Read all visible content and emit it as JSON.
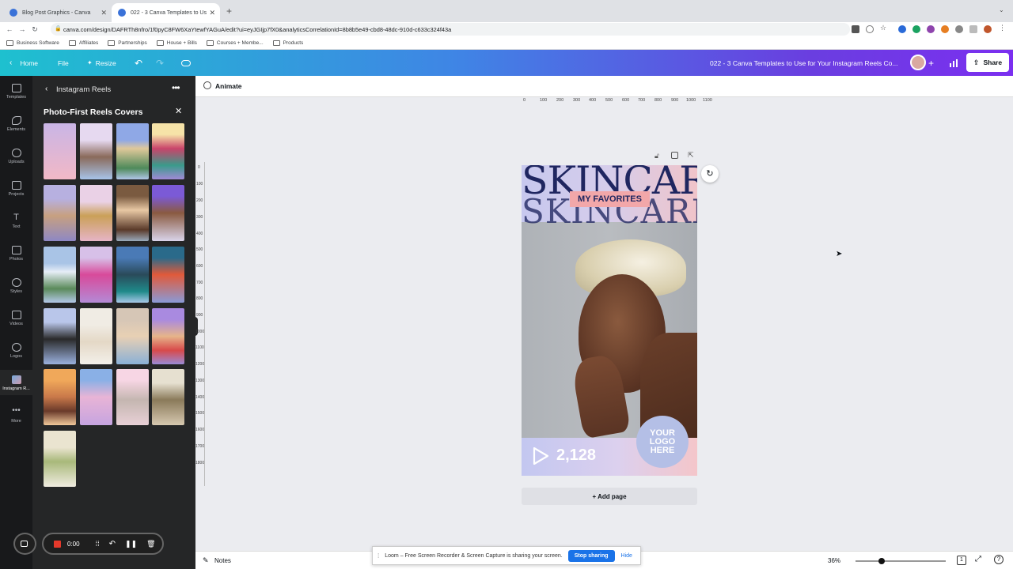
{
  "browser": {
    "tabs": [
      {
        "title": "Blog Post Graphics - Canva"
      },
      {
        "title": "022 - 3 Canva Templates to Us"
      }
    ],
    "url": "canva.com/design/DAFRTh8nfro/1f0pyC8FW6XaYtewfYAGuA/edit?ui=eyJGIjp7fX0&analyticsCorrelationId=8b8b5e49-cbd8-48dc-910d-c633c324f43a",
    "bookmarks": [
      "Business Software",
      "Affiliates",
      "Partnerships",
      "House + Bills",
      "Courses + Membe...",
      "Products"
    ]
  },
  "header": {
    "home": "Home",
    "file": "File",
    "resize": "Resize",
    "doc_title": "022 - 3 Canva Templates to Use for Your Instagram Reels Co...",
    "share": "Share"
  },
  "rail": [
    {
      "label": "Templates",
      "icon": "templates-icon"
    },
    {
      "label": "Elements",
      "icon": "elements-icon"
    },
    {
      "label": "Uploads",
      "icon": "uploads-icon"
    },
    {
      "label": "Projects",
      "icon": "projects-icon"
    },
    {
      "label": "Text",
      "icon": "text-icon"
    },
    {
      "label": "Photos",
      "icon": "photos-icon"
    },
    {
      "label": "Styles",
      "icon": "styles-icon"
    },
    {
      "label": "Videos",
      "icon": "videos-icon"
    },
    {
      "label": "Logos",
      "icon": "logos-icon"
    },
    {
      "label": "Instagram R...",
      "icon": "instagram-reels-icon"
    },
    {
      "label": "More",
      "icon": "more-icon"
    }
  ],
  "panel": {
    "back_title": "Instagram Reels",
    "section_title": "Photo-First Reels Covers"
  },
  "toolbar": {
    "animate": "Animate"
  },
  "ruler_top": [
    "0",
    "100",
    "200",
    "300",
    "400",
    "500",
    "600",
    "700",
    "800",
    "900",
    "1000",
    "1100"
  ],
  "ruler_left": [
    "0",
    "100",
    "200",
    "300",
    "400",
    "500",
    "600",
    "700",
    "800",
    "900",
    "1000",
    "1100",
    "1200",
    "1300",
    "1400",
    "1500",
    "1600",
    "1700",
    "1800"
  ],
  "design": {
    "headline": "SKINCARE",
    "headline_echo": "SKINCARE",
    "ribbon": "MY FAVORITES",
    "views": "2,128",
    "logo_text": "YOUR LOGO HERE"
  },
  "add_page": "+ Add page",
  "footer": {
    "notes": "Notes",
    "zoom": "36%",
    "page_count": "1",
    "zoom_level": 0.36
  },
  "recorder": {
    "time": "0:00"
  },
  "loom": {
    "message": "Loom – Free Screen Recorder & Screen Capture is sharing your screen.",
    "stop": "Stop sharing",
    "hide": "Hide"
  },
  "colors": {
    "accent": "#8b3dff",
    "navy": "#1f2660",
    "pink_ribbon": "#f2a7a9"
  }
}
